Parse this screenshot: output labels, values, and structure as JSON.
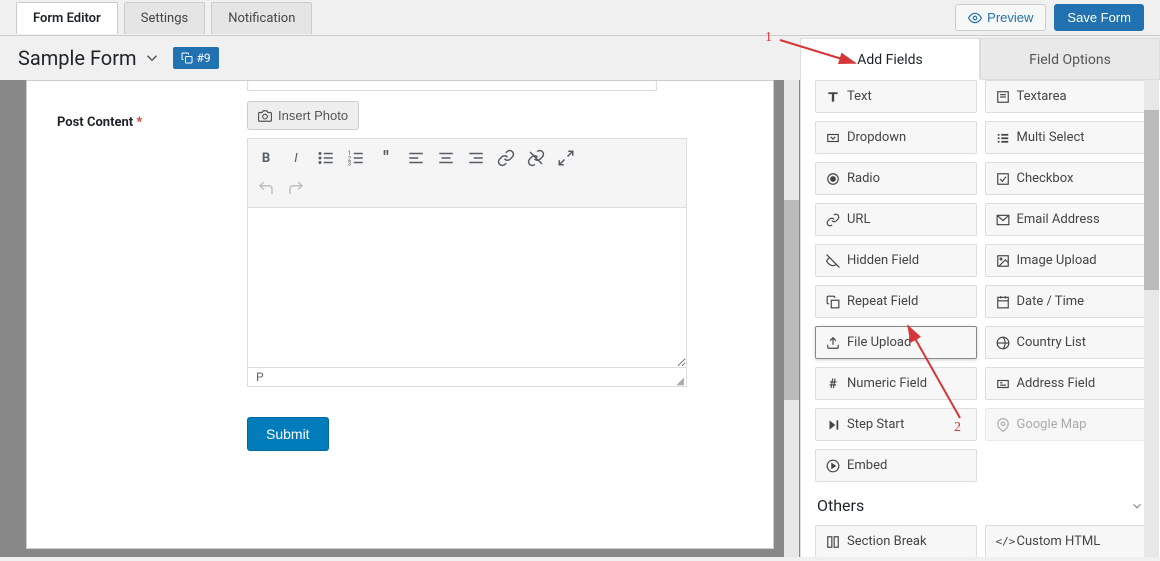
{
  "top_tabs": {
    "editor": "Form Editor",
    "settings": "Settings",
    "notification": "Notification"
  },
  "top_actions": {
    "preview": "Preview",
    "save": "Save Form"
  },
  "form": {
    "title": "Sample Form",
    "badge": "#9",
    "field_label": "Post Content",
    "required_mark": "*",
    "insert_photo": "Insert Photo",
    "status": "P",
    "submit": "Submit"
  },
  "panel": {
    "tab_add": "Add Fields",
    "tab_options": "Field Options"
  },
  "fields": {
    "text": "Text",
    "textarea": "Textarea",
    "dropdown": "Dropdown",
    "multi_select": "Multi Select",
    "radio": "Radio",
    "checkbox": "Checkbox",
    "url": "URL",
    "email": "Email Address",
    "hidden": "Hidden Field",
    "image_upload": "Image Upload",
    "repeat": "Repeat Field",
    "datetime": "Date / Time",
    "file_upload": "File Upload",
    "country": "Country List",
    "numeric": "Numeric Field",
    "address": "Address Field",
    "step_start": "Step Start",
    "google_map": "Google Map",
    "embed": "Embed"
  },
  "sections": {
    "others": "Others"
  },
  "others_fields": {
    "section_break": "Section Break",
    "custom_html": "Custom HTML"
  },
  "annotations": {
    "one": "1",
    "two": "2"
  }
}
